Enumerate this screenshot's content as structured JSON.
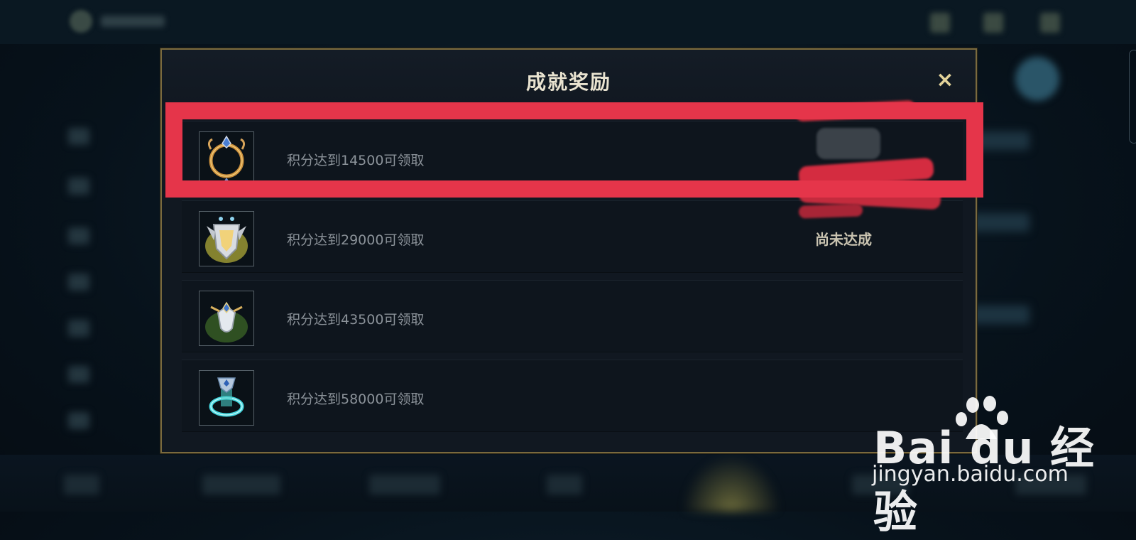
{
  "modal": {
    "title": "成就奖励",
    "close_label": "×"
  },
  "rewards": [
    {
      "condition": "积分达到14500可领取",
      "status": "",
      "icon": "ring-emblem-icon"
    },
    {
      "condition": "积分达到29000可领取",
      "status": "尚未达成",
      "icon": "shield-emblem-icon"
    },
    {
      "condition": "积分达到43500可领取",
      "status": "",
      "icon": "crystal-emblem-icon"
    },
    {
      "condition": "积分达到58000可领取",
      "status": "",
      "icon": "portal-emblem-icon"
    }
  ],
  "watermark": {
    "logo_text": "Bai du 经验",
    "url": "jingyan.baidu.com"
  },
  "colors": {
    "highlight": "#e5354a",
    "modal_border": "#7a6a3e",
    "close": "#e3d39a"
  }
}
